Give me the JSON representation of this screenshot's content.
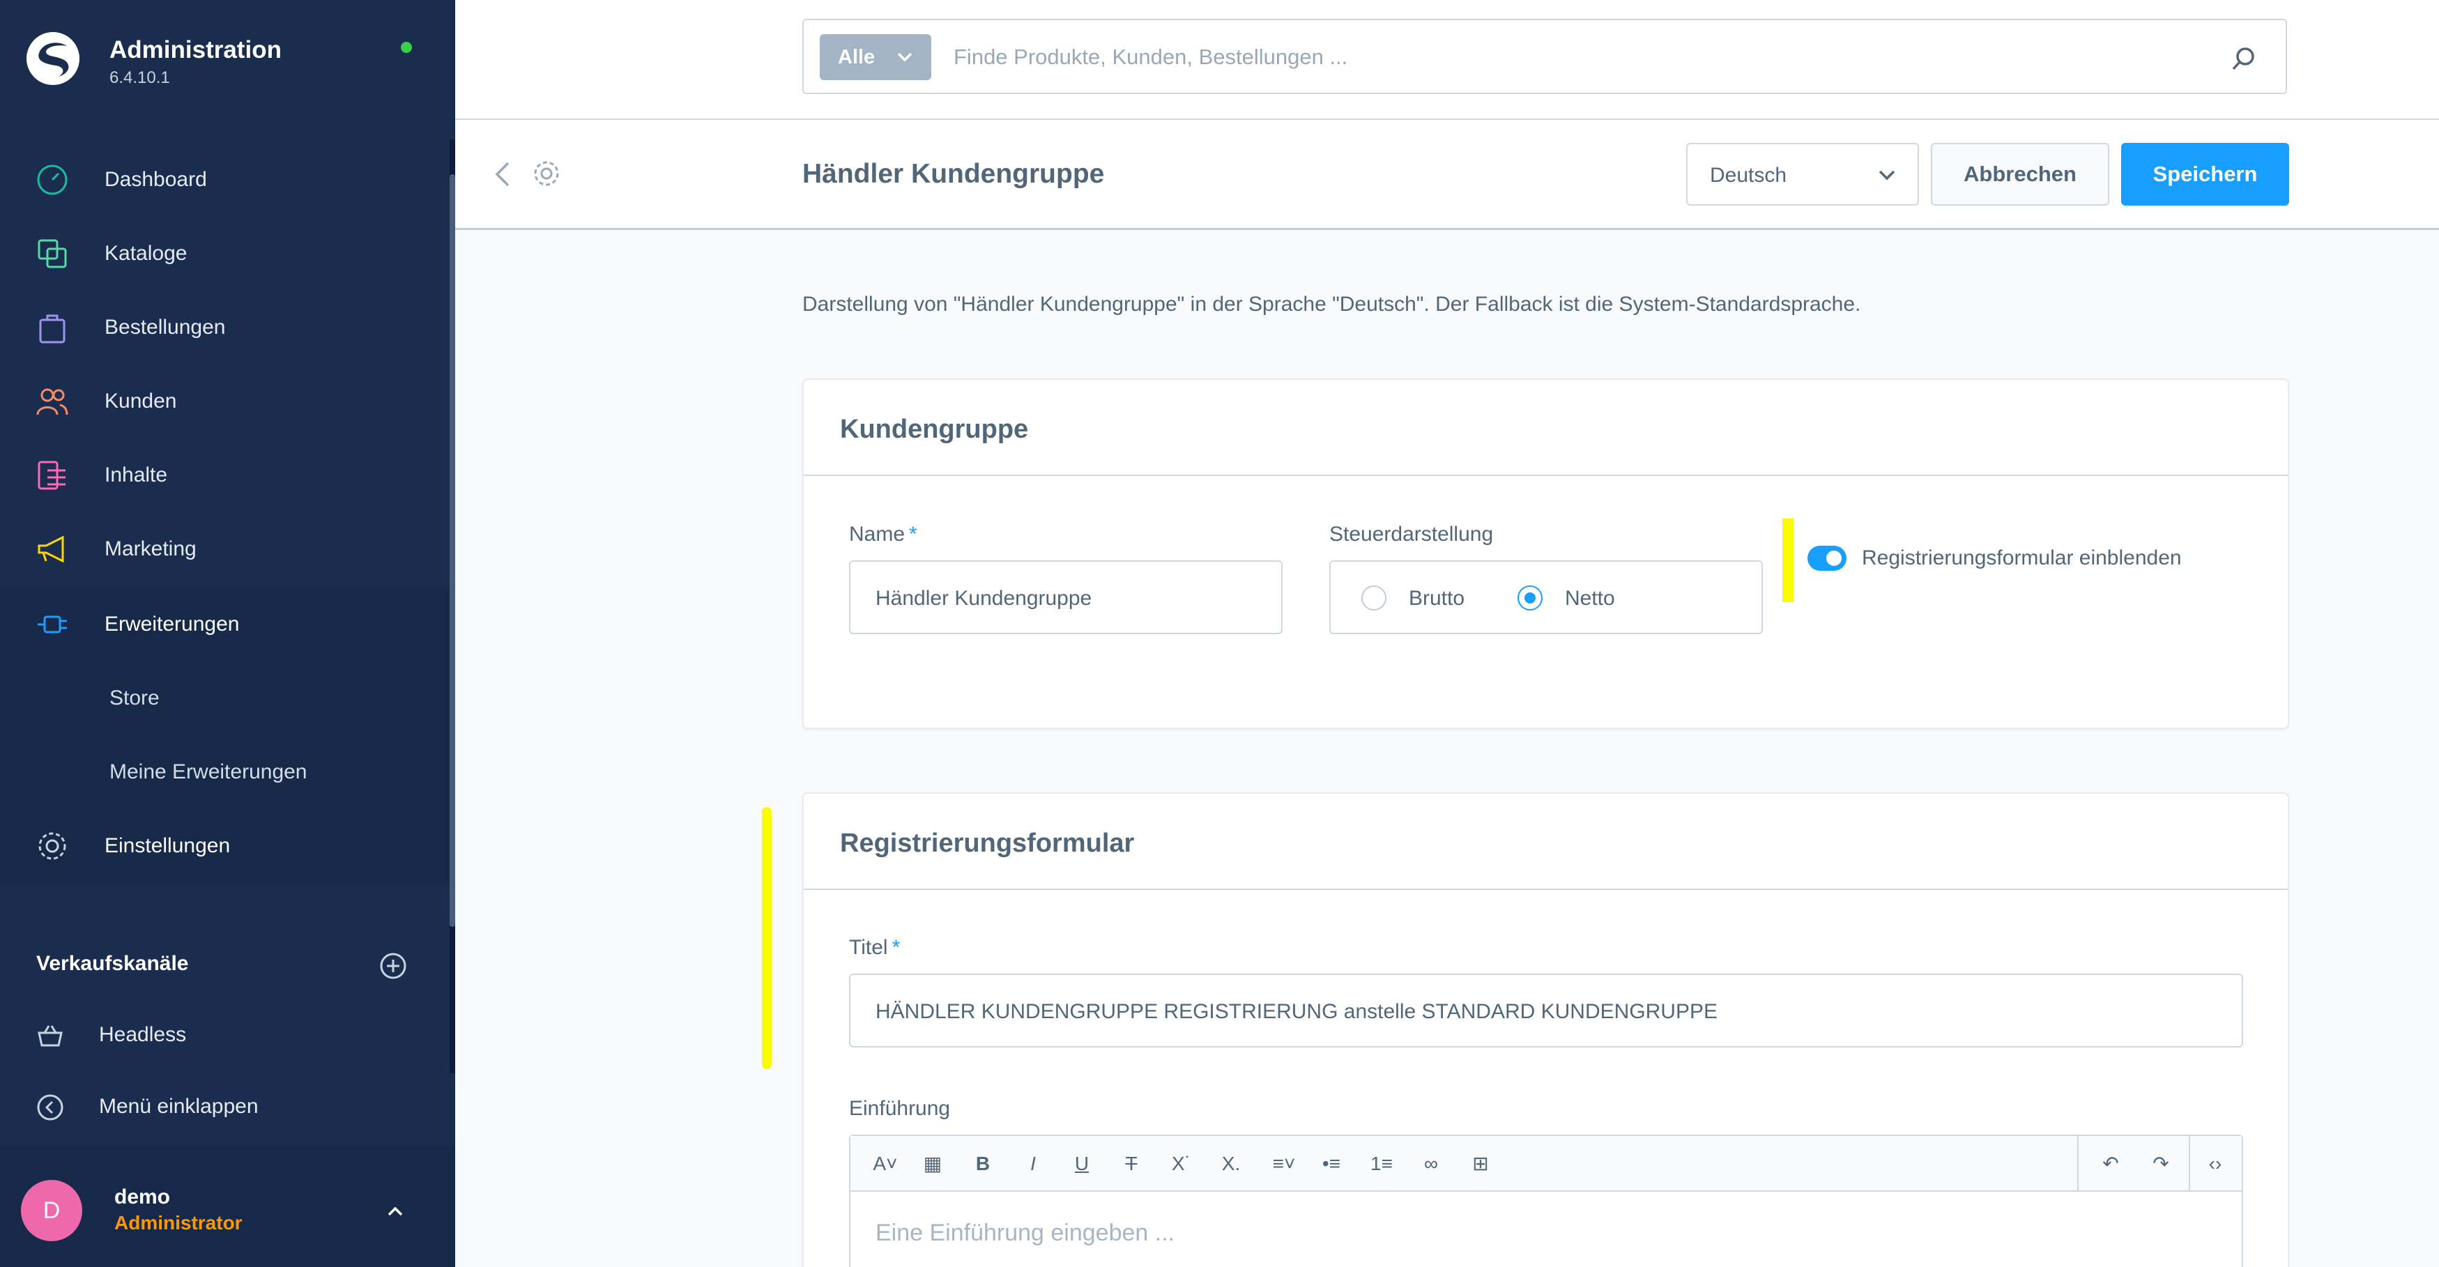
{
  "app": {
    "title": "Administration",
    "version": "6.4.10.1",
    "status_color": "#37d046"
  },
  "nav": {
    "items": [
      {
        "label": "Dashboard",
        "icon": "dashboard-icon",
        "color": "#1abc9c"
      },
      {
        "label": "Kataloge",
        "icon": "catalogue-icon",
        "color": "#57d9a3"
      },
      {
        "label": "Bestellungen",
        "icon": "orders-icon",
        "color": "#a092f0"
      },
      {
        "label": "Kunden",
        "icon": "customers-icon",
        "color": "#f88962"
      },
      {
        "label": "Inhalte",
        "icon": "content-icon",
        "color": "#ff68b4"
      },
      {
        "label": "Marketing",
        "icon": "marketing-icon",
        "color": "#ffd700"
      },
      {
        "label": "Erweiterungen",
        "icon": "extensions-icon",
        "color": "#189eff"
      }
    ],
    "sub_items": [
      {
        "label": "Store"
      },
      {
        "label": "Meine Erweiterungen"
      }
    ],
    "settings_label": "Einstellungen",
    "sales_channels_label": "Verkaufskanäle",
    "channels": [
      {
        "label": "Headless",
        "icon": "basket-icon"
      }
    ],
    "collapse_label": "Menü einklappen"
  },
  "user": {
    "initial": "D",
    "name": "demo",
    "role": "Administrator"
  },
  "search": {
    "type_label": "Alle",
    "placeholder": "Finde Produkte, Kunden, Bestellungen ..."
  },
  "smartbar": {
    "title": "Händler Kundengruppe",
    "language": "Deutsch",
    "cancel_label": "Abbrechen",
    "save_label": "Speichern"
  },
  "info_text": "Darstellung von \"Händler Kundengruppe\" in der Sprache \"Deutsch\". Der Fallback ist die System-Standardsprache.",
  "customer_group_card": {
    "title": "Kundengruppe",
    "name_label": "Name",
    "name_required": "*",
    "name_value": "Händler Kundengruppe",
    "tax_label": "Steuerdarstellung",
    "tax_options": [
      {
        "label": "Brutto",
        "checked": false
      },
      {
        "label": "Netto",
        "checked": true
      }
    ],
    "registration_toggle_label": "Registrierungsformular einblenden",
    "registration_toggle_on": true
  },
  "registration_card": {
    "title": "Registrierungsformular",
    "title_field_label": "Titel",
    "title_required": "*",
    "title_value": "HÄNDLER KUNDENGRUPPE REGISTRIERUNG anstelle STANDARD KUNDENGRUPPE",
    "intro_label": "Einführung",
    "intro_placeholder": "Eine Einführung eingeben ..."
  },
  "colors": {
    "sidebar_bg": "#1b2d4f",
    "primary": "#189eff",
    "highlight": "#fafa00",
    "role": "#ff9800",
    "avatar": "#ed69ab"
  }
}
